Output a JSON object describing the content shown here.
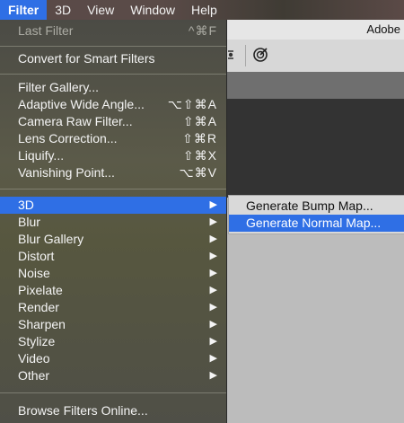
{
  "menubar": {
    "items": [
      {
        "label": "Filter"
      },
      {
        "label": "3D"
      },
      {
        "label": "View"
      },
      {
        "label": "Window"
      },
      {
        "label": "Help"
      }
    ]
  },
  "app": {
    "title_fragment": "Adobe"
  },
  "filter_menu": {
    "last_filter": {
      "label": "Last Filter",
      "shortcut": "^⌘F"
    },
    "convert": {
      "label": "Convert for Smart Filters"
    },
    "group1": [
      {
        "label": "Filter Gallery...",
        "shortcut": ""
      },
      {
        "label": "Adaptive Wide Angle...",
        "shortcut": "⌥⇧⌘A"
      },
      {
        "label": "Camera Raw Filter...",
        "shortcut": "⇧⌘A"
      },
      {
        "label": "Lens Correction...",
        "shortcut": "⇧⌘R"
      },
      {
        "label": "Liquify...",
        "shortcut": "⇧⌘X"
      },
      {
        "label": "Vanishing Point...",
        "shortcut": "⌥⌘V"
      }
    ],
    "group2": [
      {
        "label": "3D"
      },
      {
        "label": "Blur"
      },
      {
        "label": "Blur Gallery"
      },
      {
        "label": "Distort"
      },
      {
        "label": "Noise"
      },
      {
        "label": "Pixelate"
      },
      {
        "label": "Render"
      },
      {
        "label": "Sharpen"
      },
      {
        "label": "Stylize"
      },
      {
        "label": "Video"
      },
      {
        "label": "Other"
      }
    ],
    "browse": {
      "label": "Browse Filters Online..."
    },
    "submenu_arrow": "▶"
  },
  "submenu_3d": {
    "items": [
      {
        "label": "Generate Bump Map..."
      },
      {
        "label": "Generate Normal Map..."
      }
    ]
  }
}
